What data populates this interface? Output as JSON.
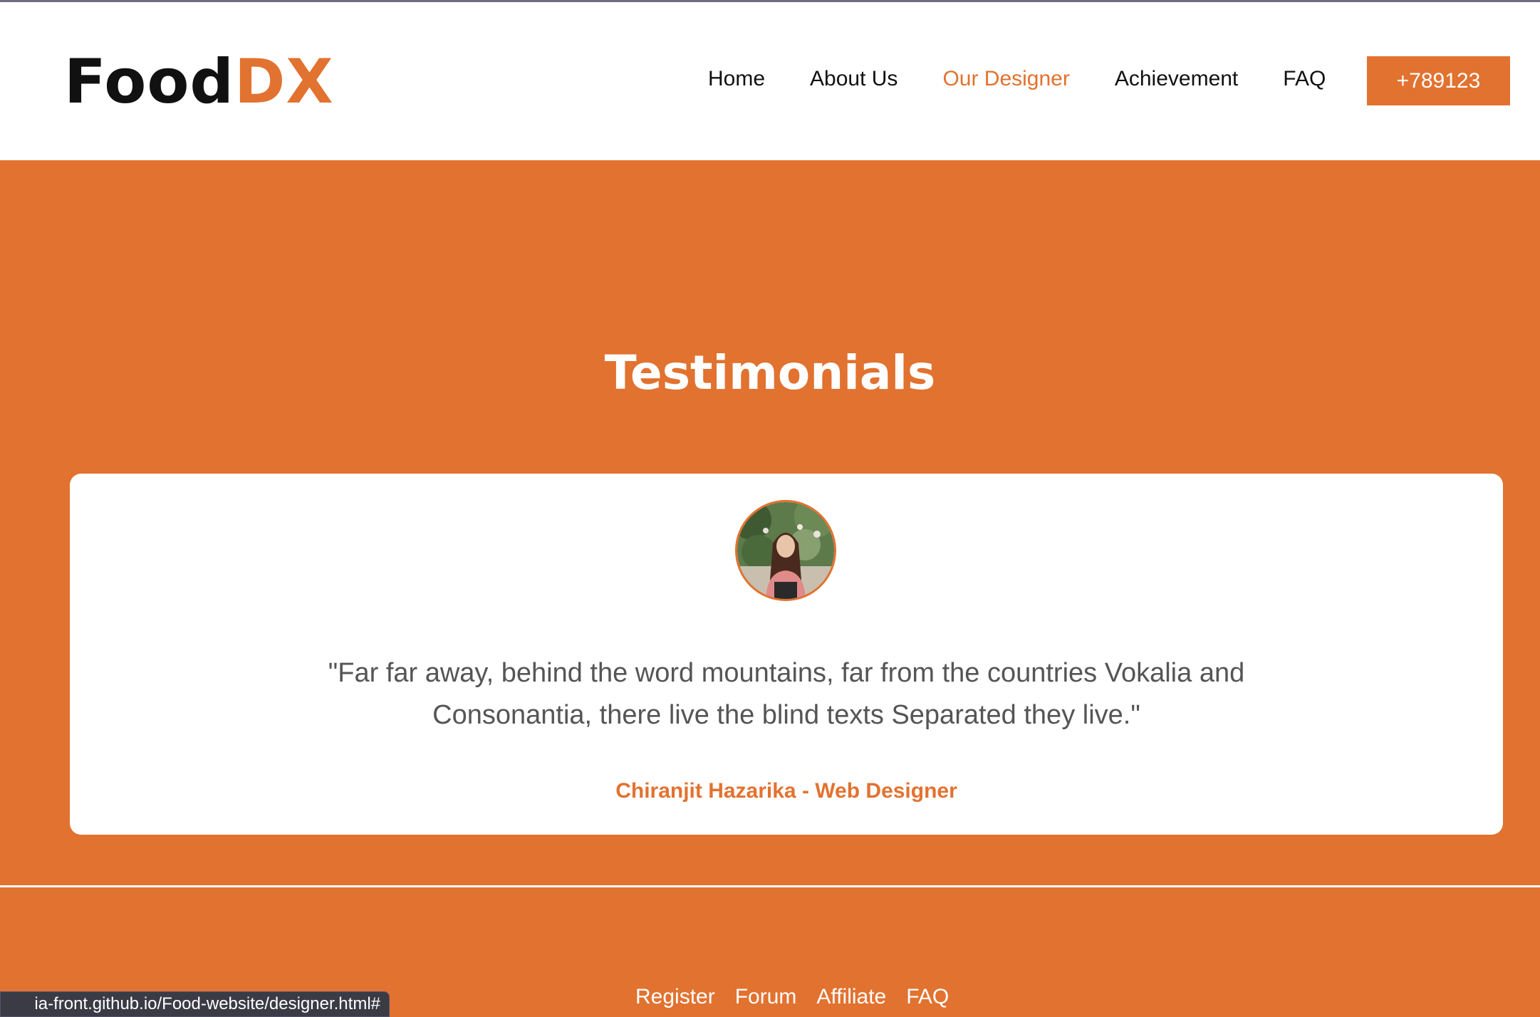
{
  "header": {
    "logo_part1": "Food",
    "logo_part2": "DX",
    "nav": [
      {
        "label": "Home",
        "active": false
      },
      {
        "label": "About Us",
        "active": false
      },
      {
        "label": "Our Designer",
        "active": true
      },
      {
        "label": "Achievement",
        "active": false
      },
      {
        "label": "FAQ",
        "active": false
      }
    ],
    "phone_button": "+789123"
  },
  "testimonials": {
    "title": "Testimonials",
    "quote": "\"Far far away, behind the word mountains, far from the countries Vokalia and Consonantia, there live the blind texts Separated they live.\"",
    "author": "Chiranjit Hazarika - Web Designer"
  },
  "footer": {
    "links": [
      "Register",
      "Forum",
      "Affiliate",
      "FAQ"
    ]
  },
  "status_bar": {
    "url": "ia-front.github.io/Food-website/designer.html#"
  },
  "colors": {
    "accent": "#e27230",
    "text_dark": "#111111",
    "quote_text": "#555555",
    "white": "#ffffff"
  }
}
